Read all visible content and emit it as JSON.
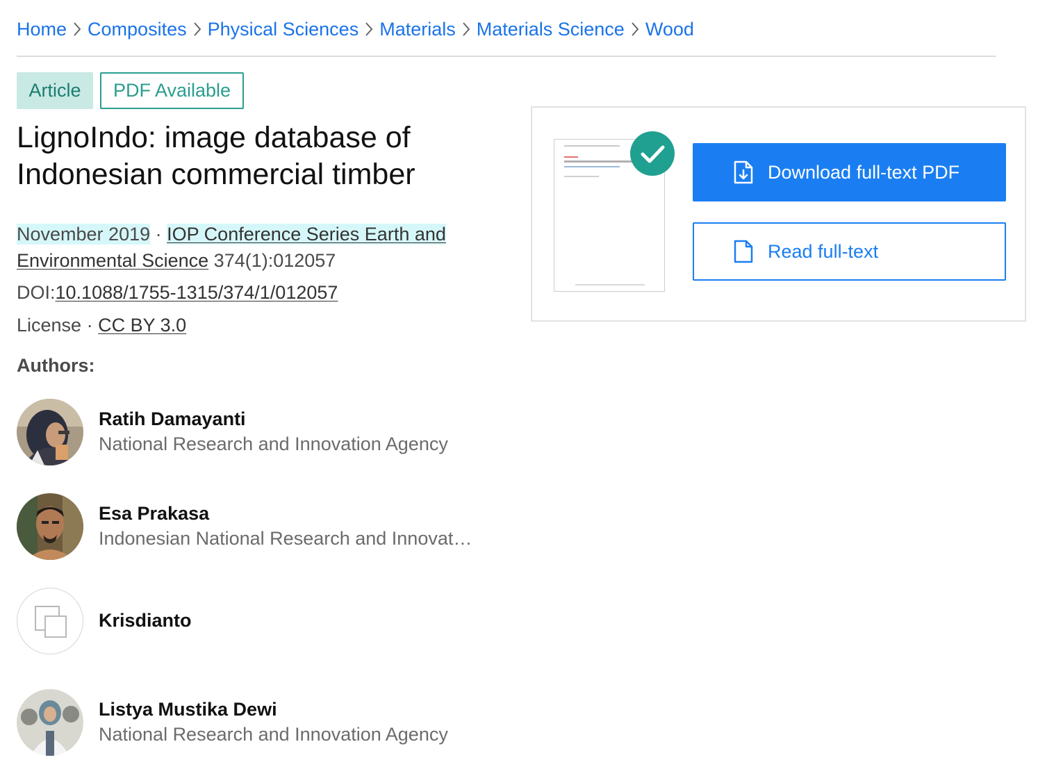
{
  "breadcrumb": {
    "items": [
      "Home",
      "Composites",
      "Physical Sciences",
      "Materials",
      "Materials Science",
      "Wood"
    ]
  },
  "badges": {
    "type": "Article",
    "availability": "PDF Available"
  },
  "publication": {
    "title": "LignoIndo: image database of Indonesian commercial timber",
    "date": "November 2019",
    "separator": "·",
    "journal": "IOP Conference Series Earth and Environmental Science",
    "journal_line1": "IOP Conference Series Earth and",
    "journal_line2": "Environmental Science",
    "volume": "374(1):012057",
    "doi_label": "DOI:",
    "doi": "10.1088/1755-1315/374/1/012057",
    "license_label": "License",
    "license": "CC BY 3.0"
  },
  "authors_heading": "Authors:",
  "authors": [
    {
      "name": "Ratih Damayanti",
      "affiliation": "National Research and Innovation Agency"
    },
    {
      "name": "Esa Prakasa",
      "affiliation": "Indonesian National Research and Innovation Agency"
    },
    {
      "name": "Krisdianto",
      "affiliation": ""
    },
    {
      "name": "Listya Mustika Dewi",
      "affiliation": "National Research and Innovation Agency"
    }
  ],
  "actions": {
    "download_label": "Download full-text PDF",
    "read_label": "Read full-text"
  },
  "colors": {
    "link": "#1a73e8",
    "primary_button": "#1a7ef2",
    "badge_teal": "#2a9d8f",
    "check_badge": "#20a090"
  },
  "icons": {
    "crumb_separator": "chevron-right-icon",
    "download": "file-download-icon",
    "read": "file-icon",
    "check": "check-icon",
    "avatar_placeholder": "avatar-placeholder-icon"
  }
}
